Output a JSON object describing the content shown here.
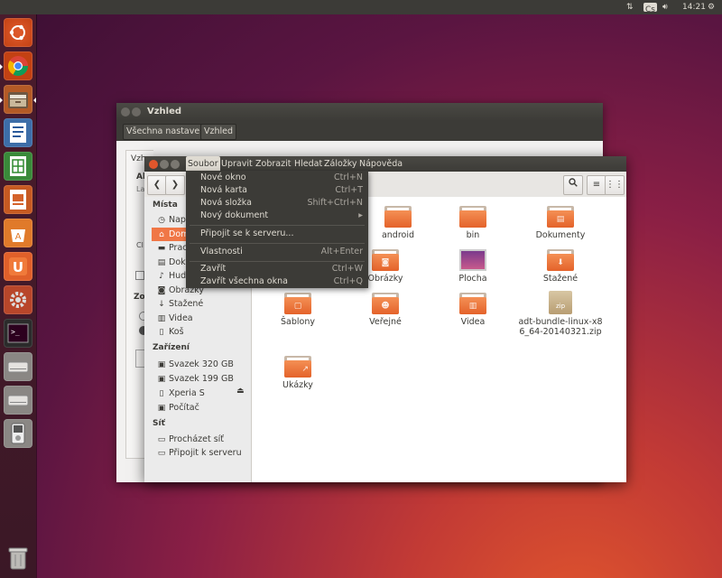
{
  "panel": {
    "time": "14:21",
    "keyboard": "Cs",
    "icons": [
      "network-updown-icon",
      "keyboard-layout-icon",
      "volume-icon",
      "gear-icon"
    ]
  },
  "launcher": {
    "items": [
      "ubuntu-dash-icon",
      "chrome-icon",
      "files-icon",
      "writer-icon",
      "calc-icon",
      "impress-icon",
      "software-center-icon",
      "ubuntu-one-icon",
      "system-settings-icon",
      "terminal-icon",
      "drive-icon",
      "drive-icon",
      "media-player-icon",
      "trash-icon"
    ]
  },
  "back_window": {
    "title": "Vzhled",
    "toolbar": [
      "Všechna nastavení",
      "Vzhled"
    ],
    "peek": [
      "Vzh",
      "Ak",
      "La",
      "Cl",
      "Zo"
    ]
  },
  "menubar": [
    "Soubor",
    "Upravit",
    "Zobrazit",
    "Hledat",
    "Záložky",
    "Nápověda"
  ],
  "file_menu": {
    "items": [
      {
        "label": "Nové okno",
        "accel": "Ctrl+N"
      },
      {
        "label": "Nová karta",
        "accel": "Ctrl+T"
      },
      {
        "label": "Nová složka",
        "accel": "Shift+Ctrl+N"
      },
      {
        "label": "Nový dokument",
        "accel": "▸"
      },
      {
        "label": "Připojit se k serveru...",
        "accel": ""
      },
      {
        "label": "Vlastnosti",
        "accel": "Alt+Enter"
      },
      {
        "label": "Zavřít",
        "accel": "Ctrl+W"
      },
      {
        "label": "Zavřít všechna okna",
        "accel": "Ctrl+Q"
      }
    ]
  },
  "sidebar": {
    "places_heading": "Místa",
    "places": [
      {
        "label": "Nap",
        "icon": "clock-icon"
      },
      {
        "label": "Dom",
        "icon": "home-icon"
      },
      {
        "label": "Prac",
        "icon": "desktop-icon"
      },
      {
        "label": "Doku",
        "icon": "documents-icon"
      },
      {
        "label": "Hudb",
        "icon": "music-icon"
      },
      {
        "label": "Obrázky",
        "icon": "camera-icon"
      },
      {
        "label": "Stažené",
        "icon": "download-icon"
      },
      {
        "label": "Videa",
        "icon": "video-icon"
      },
      {
        "label": "Koš",
        "icon": "trash-icon"
      }
    ],
    "devices_heading": "Zařízení",
    "devices": [
      {
        "label": "Svazek 320 GB",
        "icon": "drive-icon"
      },
      {
        "label": "Svazek 199 GB",
        "icon": "drive-icon"
      },
      {
        "label": "Xperia S",
        "icon": "phone-icon"
      },
      {
        "label": "Počítač",
        "icon": "drive-icon"
      }
    ],
    "network_heading": "Síť",
    "network": [
      {
        "label": "Procházet síť",
        "icon": "network-icon"
      },
      {
        "label": "Připojit k serveru",
        "icon": "network-icon"
      }
    ]
  },
  "files": [
    {
      "name": "android",
      "kind": "folder"
    },
    {
      "name": "bin",
      "kind": "folder"
    },
    {
      "name": "Dokumenty",
      "kind": "folder"
    },
    {
      "name": "Obrázky",
      "kind": "folder"
    },
    {
      "name": "Plocha",
      "kind": "folder"
    },
    {
      "name": "Stažené",
      "kind": "folder"
    },
    {
      "name": "Šablony",
      "kind": "folder"
    },
    {
      "name": "Veřejné",
      "kind": "folder"
    },
    {
      "name": "Videa",
      "kind": "folder"
    },
    {
      "name": "adt-bundle-linux-x86_64-20140321.zip",
      "kind": "zip",
      "icon_text": "zip"
    },
    {
      "name": "Ukázky",
      "kind": "folder"
    }
  ]
}
